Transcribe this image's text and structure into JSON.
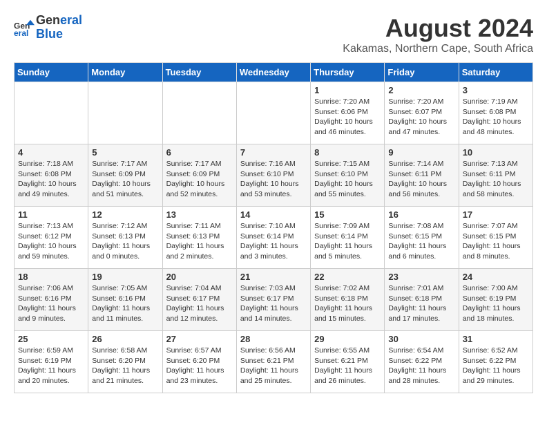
{
  "header": {
    "logo_line1": "General",
    "logo_line2": "Blue",
    "month_year": "August 2024",
    "location": "Kakamas, Northern Cape, South Africa"
  },
  "weekdays": [
    "Sunday",
    "Monday",
    "Tuesday",
    "Wednesday",
    "Thursday",
    "Friday",
    "Saturday"
  ],
  "weeks": [
    [
      {
        "day": "",
        "info": ""
      },
      {
        "day": "",
        "info": ""
      },
      {
        "day": "",
        "info": ""
      },
      {
        "day": "",
        "info": ""
      },
      {
        "day": "1",
        "info": "Sunrise: 7:20 AM\nSunset: 6:06 PM\nDaylight: 10 hours\nand 46 minutes."
      },
      {
        "day": "2",
        "info": "Sunrise: 7:20 AM\nSunset: 6:07 PM\nDaylight: 10 hours\nand 47 minutes."
      },
      {
        "day": "3",
        "info": "Sunrise: 7:19 AM\nSunset: 6:08 PM\nDaylight: 10 hours\nand 48 minutes."
      }
    ],
    [
      {
        "day": "4",
        "info": "Sunrise: 7:18 AM\nSunset: 6:08 PM\nDaylight: 10 hours\nand 49 minutes."
      },
      {
        "day": "5",
        "info": "Sunrise: 7:17 AM\nSunset: 6:09 PM\nDaylight: 10 hours\nand 51 minutes."
      },
      {
        "day": "6",
        "info": "Sunrise: 7:17 AM\nSunset: 6:09 PM\nDaylight: 10 hours\nand 52 minutes."
      },
      {
        "day": "7",
        "info": "Sunrise: 7:16 AM\nSunset: 6:10 PM\nDaylight: 10 hours\nand 53 minutes."
      },
      {
        "day": "8",
        "info": "Sunrise: 7:15 AM\nSunset: 6:10 PM\nDaylight: 10 hours\nand 55 minutes."
      },
      {
        "day": "9",
        "info": "Sunrise: 7:14 AM\nSunset: 6:11 PM\nDaylight: 10 hours\nand 56 minutes."
      },
      {
        "day": "10",
        "info": "Sunrise: 7:13 AM\nSunset: 6:11 PM\nDaylight: 10 hours\nand 58 minutes."
      }
    ],
    [
      {
        "day": "11",
        "info": "Sunrise: 7:13 AM\nSunset: 6:12 PM\nDaylight: 10 hours\nand 59 minutes."
      },
      {
        "day": "12",
        "info": "Sunrise: 7:12 AM\nSunset: 6:13 PM\nDaylight: 11 hours\nand 0 minutes."
      },
      {
        "day": "13",
        "info": "Sunrise: 7:11 AM\nSunset: 6:13 PM\nDaylight: 11 hours\nand 2 minutes."
      },
      {
        "day": "14",
        "info": "Sunrise: 7:10 AM\nSunset: 6:14 PM\nDaylight: 11 hours\nand 3 minutes."
      },
      {
        "day": "15",
        "info": "Sunrise: 7:09 AM\nSunset: 6:14 PM\nDaylight: 11 hours\nand 5 minutes."
      },
      {
        "day": "16",
        "info": "Sunrise: 7:08 AM\nSunset: 6:15 PM\nDaylight: 11 hours\nand 6 minutes."
      },
      {
        "day": "17",
        "info": "Sunrise: 7:07 AM\nSunset: 6:15 PM\nDaylight: 11 hours\nand 8 minutes."
      }
    ],
    [
      {
        "day": "18",
        "info": "Sunrise: 7:06 AM\nSunset: 6:16 PM\nDaylight: 11 hours\nand 9 minutes."
      },
      {
        "day": "19",
        "info": "Sunrise: 7:05 AM\nSunset: 6:16 PM\nDaylight: 11 hours\nand 11 minutes."
      },
      {
        "day": "20",
        "info": "Sunrise: 7:04 AM\nSunset: 6:17 PM\nDaylight: 11 hours\nand 12 minutes."
      },
      {
        "day": "21",
        "info": "Sunrise: 7:03 AM\nSunset: 6:17 PM\nDaylight: 11 hours\nand 14 minutes."
      },
      {
        "day": "22",
        "info": "Sunrise: 7:02 AM\nSunset: 6:18 PM\nDaylight: 11 hours\nand 15 minutes."
      },
      {
        "day": "23",
        "info": "Sunrise: 7:01 AM\nSunset: 6:18 PM\nDaylight: 11 hours\nand 17 minutes."
      },
      {
        "day": "24",
        "info": "Sunrise: 7:00 AM\nSunset: 6:19 PM\nDaylight: 11 hours\nand 18 minutes."
      }
    ],
    [
      {
        "day": "25",
        "info": "Sunrise: 6:59 AM\nSunset: 6:19 PM\nDaylight: 11 hours\nand 20 minutes."
      },
      {
        "day": "26",
        "info": "Sunrise: 6:58 AM\nSunset: 6:20 PM\nDaylight: 11 hours\nand 21 minutes."
      },
      {
        "day": "27",
        "info": "Sunrise: 6:57 AM\nSunset: 6:20 PM\nDaylight: 11 hours\nand 23 minutes."
      },
      {
        "day": "28",
        "info": "Sunrise: 6:56 AM\nSunset: 6:21 PM\nDaylight: 11 hours\nand 25 minutes."
      },
      {
        "day": "29",
        "info": "Sunrise: 6:55 AM\nSunset: 6:21 PM\nDaylight: 11 hours\nand 26 minutes."
      },
      {
        "day": "30",
        "info": "Sunrise: 6:54 AM\nSunset: 6:22 PM\nDaylight: 11 hours\nand 28 minutes."
      },
      {
        "day": "31",
        "info": "Sunrise: 6:52 AM\nSunset: 6:22 PM\nDaylight: 11 hours\nand 29 minutes."
      }
    ]
  ]
}
